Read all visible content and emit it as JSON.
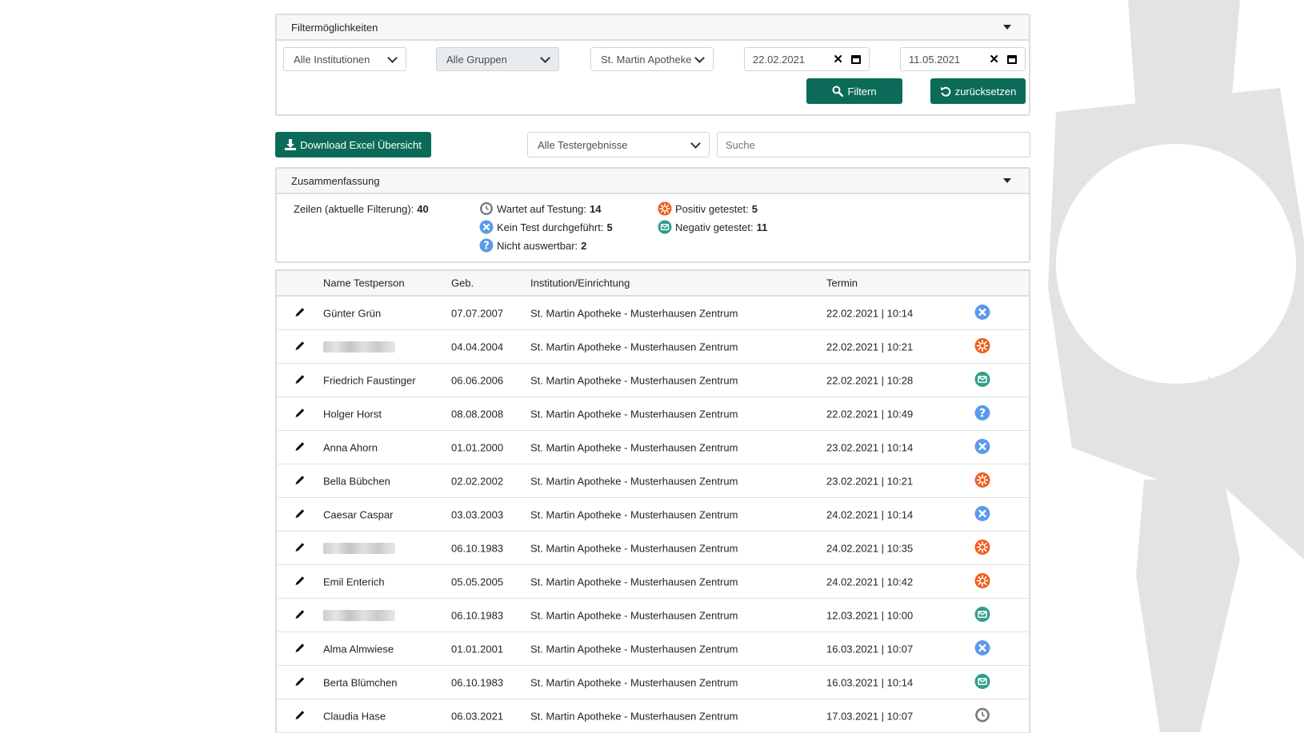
{
  "filter": {
    "title": "Filtermöglichkeiten",
    "institution": "Alle Institutionen",
    "group": "Alle Gruppen",
    "location": "St. Martin Apotheke",
    "date_from": "22.02.2021",
    "date_to": "11.05.2021",
    "filter_label": "Filtern",
    "reset_label": "zurücksetzen"
  },
  "toolbar": {
    "download_label": "Download Excel Übersicht",
    "result_select": "Alle Testergebnisse",
    "search_placeholder": "Suche"
  },
  "summary": {
    "title": "Zusammenfassung",
    "rows_label": "Zeilen (aktuelle Filterung):",
    "rows_value": "40",
    "waiting_label": "Wartet auf Testung:",
    "waiting_value": "14",
    "notest_label": "Kein Test durchgeführt:",
    "notest_value": "5",
    "unclear_label": "Nicht auswertbar:",
    "unclear_value": "2",
    "positive_label": "Positiv getestet:",
    "positive_value": "5",
    "negative_label": "Negativ getestet:",
    "negative_value": "11"
  },
  "table": {
    "headers": {
      "name": "Name Testperson",
      "geb": "Geb.",
      "inst": "Institution/Einrichtung",
      "termin": "Termin"
    },
    "rows": [
      {
        "name": "Günter Grün",
        "geb": "07.07.2007",
        "inst": "St. Martin Apotheke - Musterhausen Zentrum",
        "termin": "22.02.2021 | 10:14",
        "status": "no-test"
      },
      {
        "name": "",
        "blurred": true,
        "geb": "04.04.2004",
        "inst": "St. Martin Apotheke - Musterhausen Zentrum",
        "termin": "22.02.2021 | 10:21",
        "status": "positive"
      },
      {
        "name": "Friedrich Faustinger",
        "geb": "06.06.2006",
        "inst": "St. Martin Apotheke - Musterhausen Zentrum",
        "termin": "22.02.2021 | 10:28",
        "status": "negative"
      },
      {
        "name": "Holger Horst",
        "geb": "08.08.2008",
        "inst": "St. Martin Apotheke - Musterhausen Zentrum",
        "termin": "22.02.2021 | 10:49",
        "status": "unclear"
      },
      {
        "name": "Anna Ahorn",
        "geb": "01.01.2000",
        "inst": "St. Martin Apotheke - Musterhausen Zentrum",
        "termin": "23.02.2021 | 10:14",
        "status": "no-test"
      },
      {
        "name": "Bella Bübchen",
        "geb": "02.02.2002",
        "inst": "St. Martin Apotheke - Musterhausen Zentrum",
        "termin": "23.02.2021 | 10:21",
        "status": "positive"
      },
      {
        "name": "Caesar Caspar",
        "geb": "03.03.2003",
        "inst": "St. Martin Apotheke - Musterhausen Zentrum",
        "termin": "24.02.2021 | 10:14",
        "status": "no-test"
      },
      {
        "name": "",
        "blurred": true,
        "geb": "06.10.1983",
        "inst": "St. Martin Apotheke - Musterhausen Zentrum",
        "termin": "24.02.2021 | 10:35",
        "status": "positive"
      },
      {
        "name": "Emil Enterich",
        "geb": "05.05.2005",
        "inst": "St. Martin Apotheke - Musterhausen Zentrum",
        "termin": "24.02.2021 | 10:42",
        "status": "positive"
      },
      {
        "name": "",
        "blurred": true,
        "geb": "06.10.1983",
        "inst": "St. Martin Apotheke - Musterhausen Zentrum",
        "termin": "12.03.2021 | 10:00",
        "status": "negative"
      },
      {
        "name": "Alma Almwiese",
        "geb": "01.01.2001",
        "inst": "St. Martin Apotheke - Musterhausen Zentrum",
        "termin": "16.03.2021 | 10:07",
        "status": "no-test"
      },
      {
        "name": "Berta Blümchen",
        "geb": "06.10.1983",
        "inst": "St. Martin Apotheke - Musterhausen Zentrum",
        "termin": "16.03.2021 | 10:14",
        "status": "negative"
      },
      {
        "name": "Claudia Hase",
        "geb": "06.03.2021",
        "inst": "St. Martin Apotheke - Musterhausen Zentrum",
        "termin": "17.03.2021 | 10:07",
        "status": "waiting"
      }
    ]
  },
  "colors": {
    "brand_green": "#0c6b58",
    "no_test": "#5b9be8",
    "positive": "#f05a1a",
    "negative": "#2f9e8a",
    "unclear": "#5b9be8",
    "waiting": "#7a7a7a"
  }
}
